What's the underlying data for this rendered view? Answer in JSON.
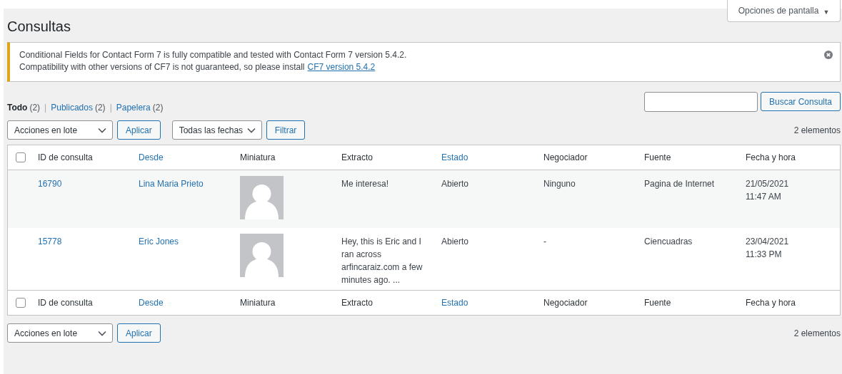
{
  "screen_options": {
    "label": "Opciones de pantalla",
    "caret": "▼"
  },
  "title": "Consultas",
  "notice": {
    "lines": [
      "Conditional Fields for Contact Form 7 is fully compatible and tested with Contact Form 7 version 5.4.2.",
      "Compatibility with other versions of CF7 is not guaranteed, so please install"
    ],
    "link": "CF7 version 5.4.2"
  },
  "views": [
    {
      "label": "Todo",
      "count": "(2)",
      "selected": true
    },
    {
      "separator": "|",
      "label": "Publicados",
      "count": "(2)",
      "selected": false
    },
    {
      "separator": "|",
      "label": "Papelera",
      "count": "(2)",
      "selected": false
    }
  ],
  "search": {
    "button": "Buscar Consulta"
  },
  "top_actions": {
    "bulk_select": "Acciones en lote",
    "apply": "Aplicar",
    "date_select": "Todas las fechas",
    "filter": "Filtrar",
    "count": "2 elementos"
  },
  "table": {
    "header": {
      "checked": false,
      "columns": [
        {
          "label": "ID de consulta",
          "sortable": false
        },
        {
          "label": "Desde",
          "sortable": true
        },
        {
          "label": "Miniatura",
          "sortable": false
        },
        {
          "label": "Extracto",
          "sortable": false
        },
        {
          "label": "Estado",
          "sortable": true
        },
        {
          "label": "Negociador",
          "sortable": false
        },
        {
          "label": "Fuente",
          "sortable": false
        },
        {
          "label": "Fecha y hora",
          "sortable": false
        }
      ]
    },
    "footer": {
      "checked": false,
      "columns": [
        {
          "label": "ID de consulta",
          "sortable": false
        },
        {
          "label": "Desde",
          "sortable": true
        },
        {
          "label": "Miniatura",
          "sortable": false
        },
        {
          "label": "Extracto",
          "sortable": false
        },
        {
          "label": "Estado",
          "sortable": true
        },
        {
          "label": "Negociador",
          "sortable": false
        },
        {
          "label": "Fuente",
          "sortable": false
        },
        {
          "label": "Fecha y hora",
          "sortable": false
        }
      ]
    },
    "rows": [
      {
        "id": "16790",
        "from": "Lina Maria Prieto",
        "excerpt": "Me interesa!",
        "status": "Abierto",
        "negotiator": "Ninguno",
        "source": "Pagina de Internet",
        "date": "21/05/2021",
        "time": "11:47 AM"
      },
      {
        "id": "15778",
        "from": "Eric Jones",
        "excerpt": "Hey, this is Eric and I ran across arfincaraiz.com a few minutes ago. ...",
        "status": "Abierto",
        "negotiator": "-",
        "source": "Ciencuadras",
        "date": "23/04/2021",
        "time": "11:33 PM"
      }
    ]
  },
  "bottom_actions": {
    "bulk_select": "Acciones en lote",
    "apply": "Aplicar",
    "count": "2 elementos"
  }
}
